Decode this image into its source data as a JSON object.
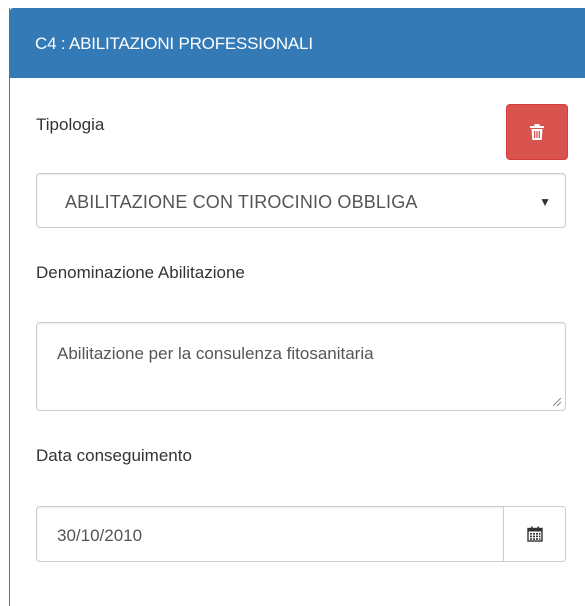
{
  "panel": {
    "title": "C4 : ABILITAZIONI PROFESSIONALI",
    "heading_color": "#337ab7"
  },
  "form": {
    "tipologia_label": "Tipologia",
    "tipologia_value": "ABILITAZIONE CON TIROCINIO OBBLIGA",
    "denominazione_label": "Denominazione Abilitazione",
    "denominazione_value": "Abilitazione per la consulenza fitosanitaria",
    "data_label": "Data conseguimento",
    "data_value": "30/10/2010"
  },
  "buttons": {
    "delete": {
      "icon": "trash-icon",
      "color": "#d9534f"
    },
    "calendar": {
      "icon": "calendar-icon"
    }
  },
  "select": {
    "caret_icon": "caret-down-icon"
  }
}
